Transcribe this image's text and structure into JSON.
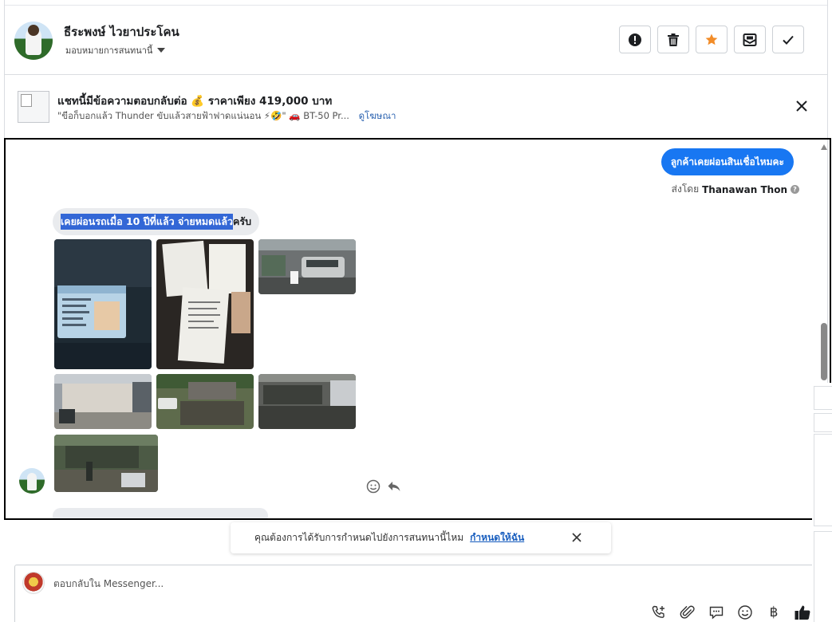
{
  "header": {
    "contact_name": "ธีระพงษ์ ไวยาประโคน",
    "assign_label": "มอบหมายการสนทนานี้",
    "actions": [
      {
        "name": "report-button",
        "icon": "alert-icon"
      },
      {
        "name": "delete-button",
        "icon": "trash-icon"
      },
      {
        "name": "star-button",
        "icon": "star-icon",
        "color": "#f28c28"
      },
      {
        "name": "mark-unread-button",
        "icon": "envelope-icon"
      },
      {
        "name": "done-button",
        "icon": "check-icon"
      }
    ]
  },
  "ad": {
    "title": "แชทนี้มีข้อความตอบกลับต่อ 💰 ราคาเพียง 419,000 บาท",
    "subtitle": "\"ขีอก็บอกแล้ว Thunder ขับแล้วสายฟ้าฟาดแน่นอน ⚡🤣\" 🚗 BT-50 Pr...",
    "link": "ดูโฆษณา"
  },
  "thread": {
    "outgoing_message": "ลูกค้าเคยผ่อนสินเชื่อไหมคะ",
    "sent_by_prefix": "ส่งโดย",
    "sent_by_name": "Thanawan Thon",
    "incoming_selected": "เคยผ่อนรถเมื่อ 10 ปีที่แล้ว จ่ายหมดแล้ว",
    "incoming_rest": "ครับ",
    "photos": [
      {
        "name": "photo-id-card"
      },
      {
        "name": "photo-documents"
      },
      {
        "name": "photo-garage-car"
      },
      {
        "name": "photo-house"
      },
      {
        "name": "photo-yard-vehicle"
      },
      {
        "name": "photo-workshop"
      },
      {
        "name": "photo-yard-wide"
      }
    ]
  },
  "prompt": {
    "text": "คุณต้องการได้รับการกำหนดไปยังการสนทนานี้ไหม",
    "link": "กำหนดให้ฉัน"
  },
  "composer": {
    "placeholder": "ตอบกลับใน Messenger..."
  },
  "colors": {
    "accent": "#1877f2",
    "link": "#1a5fbf",
    "star": "#f28c28"
  }
}
